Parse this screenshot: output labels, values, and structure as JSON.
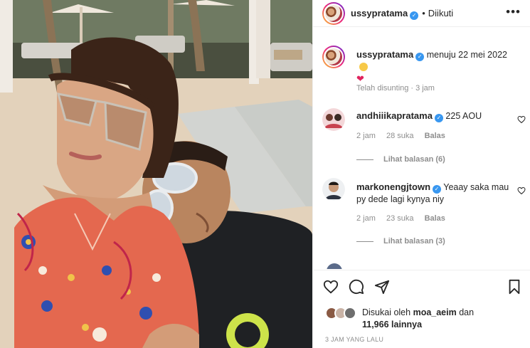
{
  "header": {
    "username": "ussypratama",
    "separator": "•",
    "follow_state": "Diikuti",
    "more_icon": "more-horizontal-icon"
  },
  "caption": {
    "username": "ussypratama",
    "text": "menuju 22 mei 2022",
    "edited": "Telah disunting",
    "time": "3 jam"
  },
  "comments": [
    {
      "username": "andhiiikapratama",
      "text": "225 AOU",
      "time": "2 jam",
      "likes": "28 suka",
      "reply": "Balas",
      "view_replies": "Lihat balasan (6)"
    },
    {
      "username": "markonengjtown",
      "text": "Yeaay saka mau py dede lagi kynya niy",
      "time": "2 jam",
      "likes": "23 suka",
      "reply": "Balas",
      "view_replies": "Lihat balasan (3)"
    }
  ],
  "likes": {
    "prefix": "Disukai oleh",
    "user": "moa_aeim",
    "conjunction": "dan",
    "count": "11,966 lainnya"
  },
  "timestamp": "3 JAM YANG LALU",
  "colors": {
    "verified": "#3897f0",
    "secondary_text": "#8e8e8e",
    "heart": "#e0245e"
  }
}
